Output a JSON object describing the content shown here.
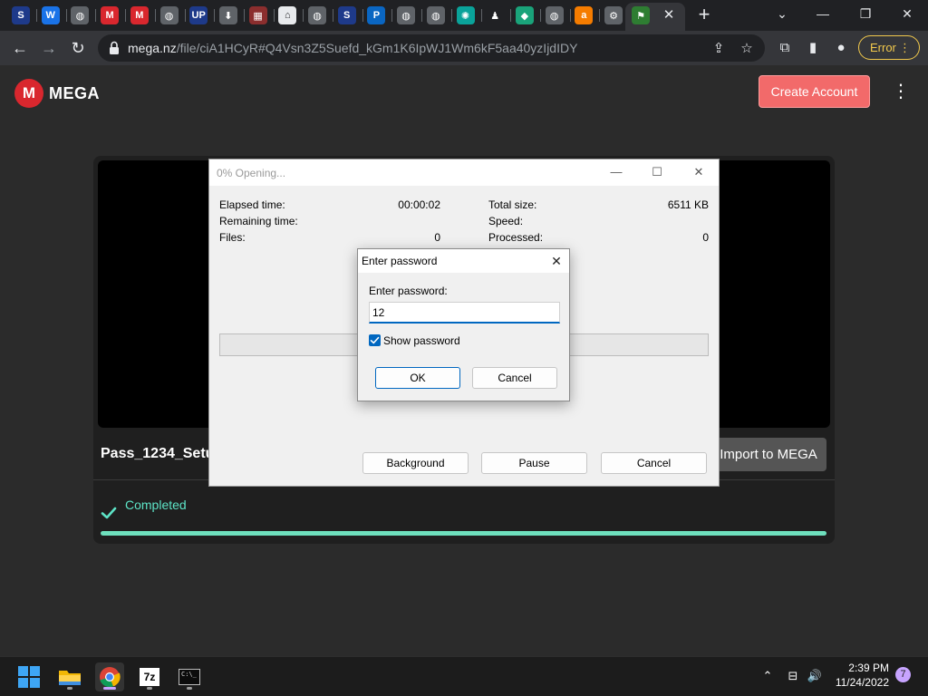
{
  "browser": {
    "tabs": [
      {
        "icon": "scribd-s-icon",
        "glyph": "S",
        "color": "#1e3a8a"
      },
      {
        "icon": "word-w-icon",
        "glyph": "W",
        "color": "#1a73e8"
      },
      {
        "icon": "globe-icon",
        "glyph": "◍",
        "color": "#5f6368"
      },
      {
        "icon": "mega-icon",
        "glyph": "M",
        "color": "#d9272e"
      },
      {
        "icon": "mega-icon",
        "glyph": "M",
        "color": "#d9272e"
      },
      {
        "icon": "globe-icon",
        "glyph": "◍",
        "color": "#5f6368"
      },
      {
        "icon": "up-icon",
        "glyph": "UP",
        "color": "#1e3a8a"
      },
      {
        "icon": "download-icon",
        "glyph": "⬇",
        "color": "#5f6368"
      },
      {
        "icon": "film-icon",
        "glyph": "▦",
        "color": "#8b2e2e"
      },
      {
        "icon": "house-icon",
        "glyph": "⌂",
        "color": "#ffffff"
      },
      {
        "icon": "globe-icon",
        "glyph": "◍",
        "color": "#5f6368"
      },
      {
        "icon": "scribd-s-icon",
        "glyph": "S",
        "color": "#1e3a8a"
      },
      {
        "icon": "p-icon",
        "glyph": "P",
        "color": "#0a66c2"
      },
      {
        "icon": "globe-icon",
        "glyph": "◍",
        "color": "#5f6368"
      },
      {
        "icon": "globe-icon",
        "glyph": "◍",
        "color": "#5f6368"
      },
      {
        "icon": "gear-badge-icon",
        "glyph": "✺",
        "color": "#0aa39a"
      },
      {
        "icon": "person-icon",
        "glyph": "♟",
        "color": "#202124"
      },
      {
        "icon": "cube-icon",
        "glyph": "◆",
        "color": "#1aa37a"
      },
      {
        "icon": "globe-icon",
        "glyph": "◍",
        "color": "#5f6368"
      },
      {
        "icon": "avast-icon",
        "glyph": "a",
        "color": "#f57c00"
      },
      {
        "icon": "gear-icon",
        "glyph": "⚙",
        "color": "#5f6368"
      },
      {
        "icon": "flag-icon",
        "glyph": "⚑",
        "color": "#2e7d32"
      }
    ],
    "tab_close_glyph": "✕",
    "new_tab_glyph": "+",
    "window_controls": {
      "dropdown": "⌄",
      "minimize": "—",
      "restore": "❐",
      "close": "✕"
    },
    "nav": {
      "back": "←",
      "forward": "→",
      "reload": "↻"
    },
    "url_host": "mega.nz",
    "url_path": "/file/ciA1HCyR#Q4Vsn3Z5Suefd_kGm1K6IpWJ1Wm6kF5aa40yzIjdIDY",
    "toolbar_icons": {
      "share": "⇪",
      "star": "☆",
      "extensions": "⧉",
      "sidepanel": "▮",
      "profile": "●"
    },
    "error_label": "Error",
    "menu_dots": "⋮"
  },
  "mega": {
    "logo_letter": "M",
    "logo_word": "MEGA",
    "create_account": "Create Account",
    "menu_dots": "⋮",
    "file_name": "Pass_1234_Setup",
    "import_button": "Import to MEGA",
    "status": "Completed",
    "progress_fraction": 1.0,
    "colors": {
      "accent": "#d9272e",
      "success": "#5de4c7",
      "create": "#f26a6a"
    }
  },
  "zip_dialog": {
    "title": "0% Opening...",
    "controls": {
      "minimize": "—",
      "maximize": "☐",
      "close": "✕"
    },
    "left_labels": [
      "Elapsed time:",
      "Remaining time:",
      "Files:"
    ],
    "left_values": [
      "00:00:02",
      "",
      "0"
    ],
    "right_labels": [
      "Total size:",
      "Speed:",
      "Processed:"
    ],
    "right_values": [
      "6511 KB",
      "",
      "0"
    ],
    "progress_fraction": 0.0,
    "buttons": {
      "background": "Background",
      "pause": "Pause",
      "cancel": "Cancel"
    }
  },
  "password_dialog": {
    "title": "Enter password",
    "close": "✕",
    "label": "Enter password:",
    "value": "12",
    "show_password_label": "Show password",
    "show_password_checked": true,
    "check_glyph": "✓",
    "ok": "OK",
    "cancel": "Cancel"
  },
  "taskbar": {
    "apps": [
      {
        "name": "start-button",
        "active": false
      },
      {
        "name": "file-explorer",
        "active": false
      },
      {
        "name": "chrome",
        "active": true
      },
      {
        "name": "7zip",
        "active": false
      },
      {
        "name": "terminal",
        "active": false
      }
    ],
    "sevenzip_label": "7z",
    "terminal_label": "C:\\_",
    "tray": {
      "chevron": "⌃",
      "network": "⊟",
      "volume": "🔊"
    },
    "time": "2:39 PM",
    "date": "11/24/2022",
    "notifications": "7"
  }
}
